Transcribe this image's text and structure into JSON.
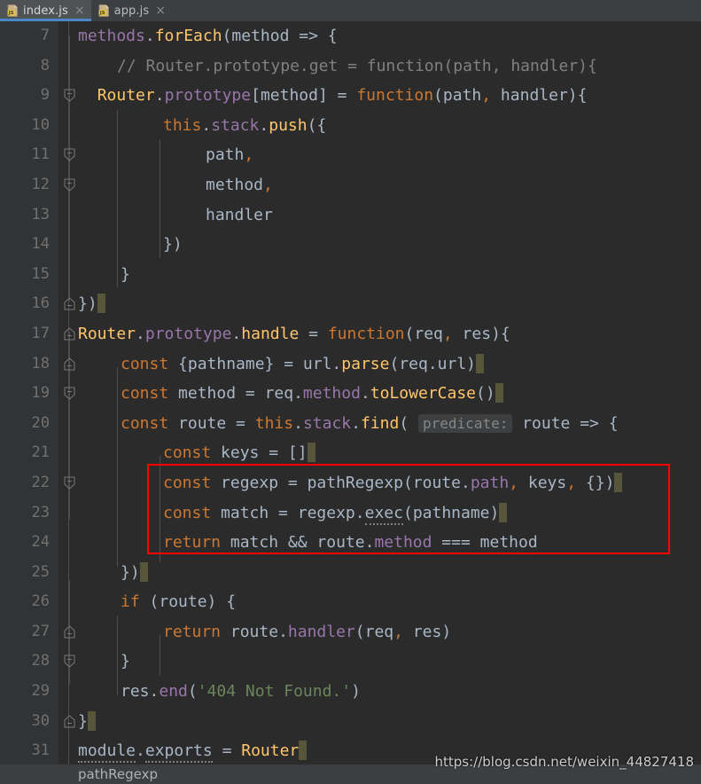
{
  "tabs": [
    {
      "name": "index.js",
      "icon": "js-file-icon",
      "active": true,
      "close": "×"
    },
    {
      "name": "app.js",
      "icon": "js-file-icon",
      "active": false,
      "close": "×"
    }
  ],
  "editor": {
    "first_line": 7,
    "lines": [
      {
        "n": 7,
        "fold": "start",
        "indent": 0
      },
      {
        "n": 8,
        "fold": "none",
        "indent": 1
      },
      {
        "n": 9,
        "fold": "start",
        "indent": 1
      },
      {
        "n": 10,
        "fold": "start",
        "indent": 2
      },
      {
        "n": 11,
        "fold": "none",
        "indent": 3
      },
      {
        "n": 12,
        "fold": "none",
        "indent": 3
      },
      {
        "n": 13,
        "fold": "none",
        "indent": 3
      },
      {
        "n": 14,
        "fold": "end",
        "indent": 2
      },
      {
        "n": 15,
        "fold": "end",
        "indent": 1
      },
      {
        "n": 16,
        "fold": "end",
        "indent": 0
      },
      {
        "n": 17,
        "fold": "start",
        "indent": 0
      },
      {
        "n": 18,
        "fold": "none",
        "indent": 1
      },
      {
        "n": 19,
        "fold": "none",
        "indent": 1
      },
      {
        "n": 20,
        "fold": "start",
        "indent": 1
      },
      {
        "n": 21,
        "fold": "none",
        "indent": 2
      },
      {
        "n": 22,
        "fold": "none",
        "indent": 2
      },
      {
        "n": 23,
        "fold": "none",
        "indent": 2
      },
      {
        "n": 24,
        "fold": "none",
        "indent": 2
      },
      {
        "n": 25,
        "fold": "end",
        "indent": 1
      },
      {
        "n": 26,
        "fold": "start",
        "indent": 1
      },
      {
        "n": 27,
        "fold": "none",
        "indent": 2
      },
      {
        "n": 28,
        "fold": "end",
        "indent": 1
      },
      {
        "n": 29,
        "fold": "none",
        "indent": 1
      },
      {
        "n": 30,
        "fold": "end",
        "indent": 0
      },
      {
        "n": 31,
        "fold": "none",
        "indent": 0
      }
    ],
    "code": {
      "l7": "methods.forEach(method => {",
      "l8": "// Router.prototype.get = function(path, handler){",
      "l9": "Router.prototype[method] = function(path, handler){",
      "l10": "this.stack.push({",
      "l11": "path,",
      "l12": "method,",
      "l13": "handler",
      "l14": "})",
      "l15": "}",
      "l16": "})",
      "l17": "Router.prototype.handle = function(req, res){",
      "l18": "const {pathname} = url.parse(req.url)",
      "l19": "const method = req.method.toLowerCase()",
      "l20": "const route = this.stack.find( predicate: route => {",
      "l21": "const keys = []",
      "l22": "const regexp = pathRegexp(route.path, keys, {})",
      "l23": "const match = regexp.exec(pathname)",
      "l24": "return match && route.method === method",
      "l25": "})",
      "l26": "if (route) {",
      "l27": "return route.handler(req, res)",
      "l28": "}",
      "l29": "res.end('404 Not Found.')",
      "l30": "}",
      "l31": "module.exports = Router"
    },
    "inlay_hints": {
      "line20": "predicate:"
    },
    "highlight_box": {
      "lines": "22-24",
      "color": "#ff0000"
    }
  },
  "statusbar": {
    "text": "pathRegexp"
  },
  "watermark": {
    "text": "https://blog.csdn.net/weixin_44827418"
  },
  "colors": {
    "background": "#2b2b2b",
    "gutter": "#313335",
    "tabbar": "#3c3f41",
    "active_tab": "#4e5254",
    "tab_underline": "#4a88c7",
    "default_text": "#a9b7c6",
    "keyword": "#cc7832",
    "function": "#ffc66d",
    "property": "#9876aa",
    "string": "#6a8759",
    "comment": "#808080",
    "eol_marker": "#57553a",
    "error_box": "#ff0000"
  }
}
